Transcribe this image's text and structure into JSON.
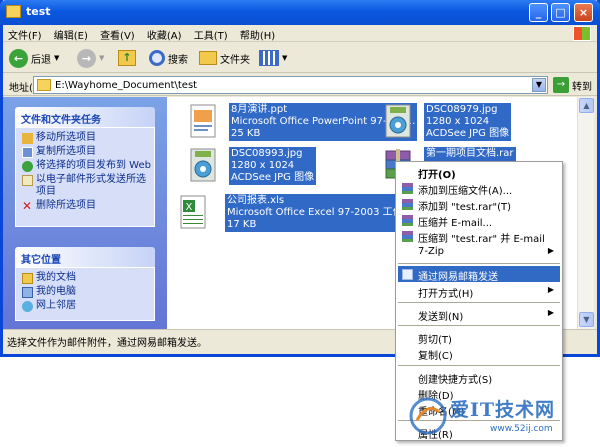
{
  "window": {
    "title": "test"
  },
  "menubar": [
    {
      "label": "文件(F)"
    },
    {
      "label": "编辑(E)"
    },
    {
      "label": "查看(V)"
    },
    {
      "label": "收藏(A)"
    },
    {
      "label": "工具(T)"
    },
    {
      "label": "帮助(H)"
    }
  ],
  "toolbar": {
    "back_label": "后退",
    "search_label": "搜索",
    "folders_label": "文件夹"
  },
  "address": {
    "label": "地址(D)",
    "path": "E:\\Wayhome_Document\\test",
    "go_label": "转到"
  },
  "sidebar": {
    "tasks_title": "文件和文件夹任务",
    "tasks": [
      {
        "label": "移动所选项目",
        "icon": "move-icon"
      },
      {
        "label": "复制所选项目",
        "icon": "copy-icon"
      },
      {
        "label": "将选择的项目发布到 Web",
        "icon": "web-publish-icon"
      },
      {
        "label": "以电子邮件形式发送所选项目",
        "icon": "email-icon"
      },
      {
        "label": "删除所选项目",
        "icon": "delete-icon"
      }
    ],
    "places_title": "其它位置",
    "places": [
      {
        "label": "我的文档",
        "icon": "my-documents-icon"
      },
      {
        "label": "我的电脑",
        "icon": "my-computer-icon"
      },
      {
        "label": "网上邻居",
        "icon": "network-icon"
      }
    ]
  },
  "files": [
    {
      "name": "8月演讲.ppt",
      "detail1": "Microsoft Office PowerPoint 97-200...",
      "detail2": "25 KB",
      "icon": "powerpoint-file-icon"
    },
    {
      "name": "DSC08979.jpg",
      "detail1": "1280 x 1024",
      "detail2": "ACDSee JPG 图像",
      "icon": "jpg-file-icon"
    },
    {
      "name": "DSC08993.jpg",
      "detail1": "1280 x 1024",
      "detail2": "ACDSee JPG 图像",
      "icon": "jpg-file-icon"
    },
    {
      "name": "第一期项目文档.rar",
      "detail1": "",
      "detail2": "",
      "icon": "rar-file-icon"
    },
    {
      "name": "公司报表.xls",
      "detail1": "Microsoft Office Excel 97-2003 工作表",
      "detail2": "17 KB",
      "icon": "excel-file-icon"
    }
  ],
  "context_menu": {
    "items": [
      {
        "label": "打开(O)",
        "bold": true
      },
      {
        "label": "添加到压缩文件(A)...",
        "icon": "winrar-icon"
      },
      {
        "label": "添加到 \"test.rar\"(T)",
        "icon": "winrar-icon"
      },
      {
        "label": "压缩并 E-mail...",
        "icon": "winrar-icon"
      },
      {
        "label": "压缩到 \"test.rar\" 并 E-mail",
        "icon": "winrar-icon"
      },
      {
        "label": "7-Zip",
        "submenu": true
      },
      {
        "label": "通过网易邮箱发送",
        "highlighted": true,
        "icon": "netease-mail-icon"
      },
      {
        "label": "打开方式(H)",
        "submenu": true
      },
      {
        "label": "发送到(N)",
        "submenu": true
      },
      {
        "label": "剪切(T)"
      },
      {
        "label": "复制(C)"
      },
      {
        "label": "创建快捷方式(S)"
      },
      {
        "label": "删除(D)"
      },
      {
        "label": "重命名(M)"
      },
      {
        "label": "属性(R)"
      }
    ]
  },
  "status_bar": {
    "text": "选择文件作为邮件附件，通过网易邮箱发送。"
  },
  "watermark": {
    "brand": "爱IT技术网",
    "url": "www.52ij.com"
  }
}
